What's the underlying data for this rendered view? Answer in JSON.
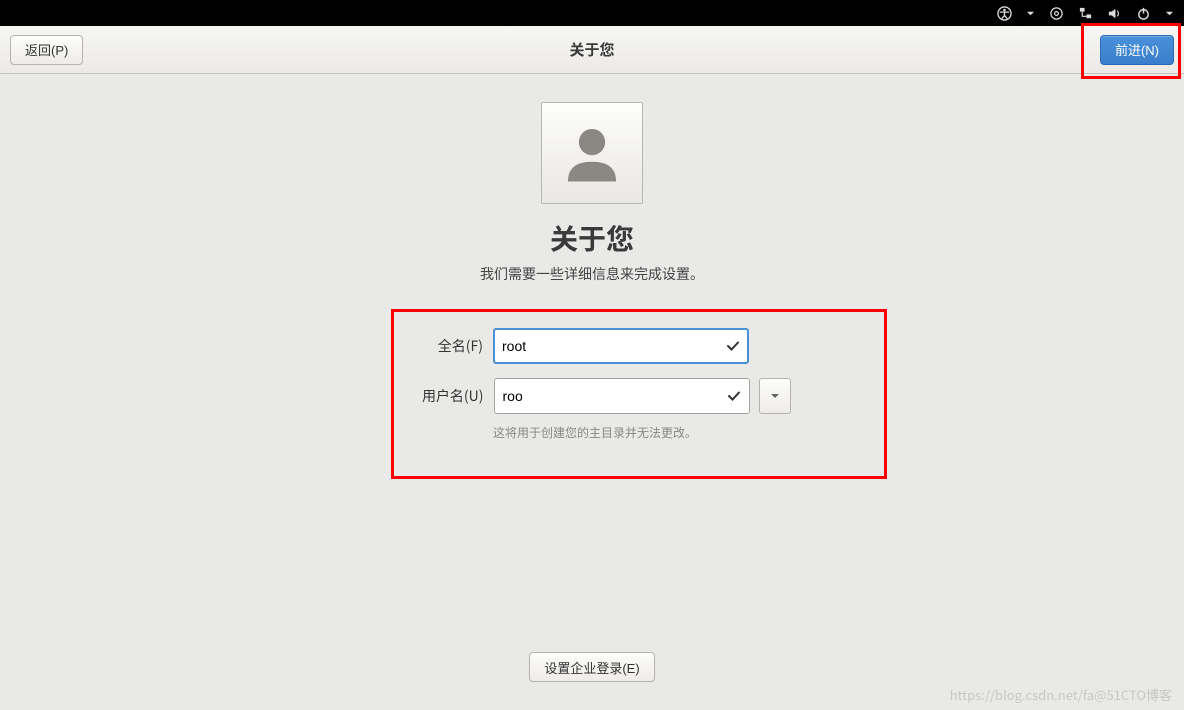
{
  "sysbar": {
    "icons": [
      "accessibility",
      "caret",
      "settings-gear",
      "network",
      "volume",
      "power",
      "caret"
    ]
  },
  "header": {
    "back_label": "返回(P)",
    "title": "关于您",
    "next_label": "前进(N)"
  },
  "main": {
    "title": "关于您",
    "subtitle": "我们需要一些详细信息来完成设置。"
  },
  "form": {
    "fullname_label": "全名(F)",
    "fullname_value": "root",
    "username_label": "用户名(U)",
    "username_value": "roo",
    "username_hint": "这将用于创建您的主目录并无法更改。"
  },
  "footer": {
    "enterprise_login_label": "设置企业登录(E)"
  },
  "watermark": "https://blog.csdn.net/fa@51CTO博客"
}
